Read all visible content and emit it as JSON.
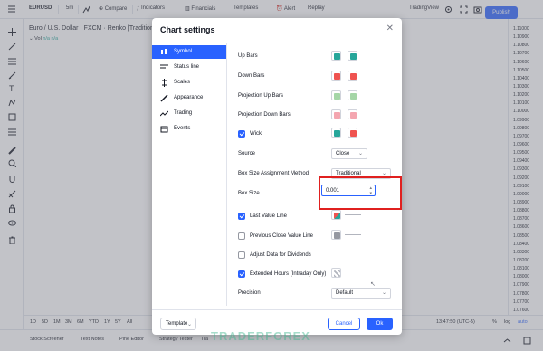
{
  "topbar": {
    "symbol": "EURUSD",
    "interval": "5m",
    "compare": "Compare",
    "indicators": "Indicators",
    "financials": "Financials",
    "templates": "Templates",
    "alert": "Alert",
    "replay": "Replay",
    "tradingview": "TradingView",
    "publish": "Publish"
  },
  "legend": {
    "line": "Euro / U.S. Dollar · FXCM · Renko [Traditional,",
    "vol_label": "Vol",
    "vol_value": "n/a n/a"
  },
  "price_axis": {
    "ticks": [
      "1.11000",
      "1.10900",
      "1.10800",
      "1.10700",
      "1.10600",
      "1.10500",
      "1.10400",
      "1.10300",
      "1.10200",
      "1.10100",
      "1.10000",
      "1.09900",
      "1.09800",
      "1.09700",
      "1.09600",
      "1.09500",
      "1.09400",
      "1.09300",
      "1.09200",
      "1.09100",
      "1.09000",
      "1.08900",
      "1.08800",
      "1.08700",
      "1.08600",
      "1.08500",
      "1.08400",
      "1.08300",
      "1.08200",
      "1.08100",
      "1.08000",
      "1.07900",
      "1.07800",
      "1.07700",
      "1.07600"
    ]
  },
  "range_bar": {
    "ranges": [
      "1D",
      "5D",
      "1M",
      "3M",
      "6M",
      "YTD",
      "1Y",
      "5Y",
      "All"
    ],
    "goto": "Go",
    "time": "13:47:50 (UTC-5)",
    "percent": "%",
    "log": "log",
    "auto": "auto"
  },
  "bottom_tabs": [
    "Stock Screener",
    "Text Notes",
    "Pine Editor",
    "Strategy Tester",
    "Tra"
  ],
  "dialog": {
    "title": "Chart settings",
    "nav": [
      "Symbol",
      "Status line",
      "Scales",
      "Appearance",
      "Trading",
      "Events"
    ],
    "rows": {
      "up_bars": "Up Bars",
      "down_bars": "Down Bars",
      "proj_up": "Projection Up Bars",
      "proj_down": "Projection Down Bars",
      "wick": "Wick",
      "source_label": "Source",
      "source_value": "Close",
      "method_label": "Box Size Assignment Method",
      "method_value": "Traditional",
      "boxsize_label": "Box Size",
      "boxsize_value": "0.001",
      "last_value": "Last Value Line",
      "prev_close": "Previous Close Value Line",
      "adjust": "Adjust Data for Dividends",
      "extended": "Extended Hours (Intraday Only)",
      "precision_label": "Precision",
      "precision_value": "Default"
    },
    "footer": {
      "template": "Template",
      "cancel": "Cancel",
      "ok": "Ok"
    },
    "colors": {
      "up": "#26a69a",
      "down": "#ef5350",
      "proj_up": "#a5d6a7",
      "proj_down": "#f4a6b0",
      "accent": "#2962ff",
      "highlight": "#e0201f"
    }
  },
  "watermark": "TRADERFOREX"
}
